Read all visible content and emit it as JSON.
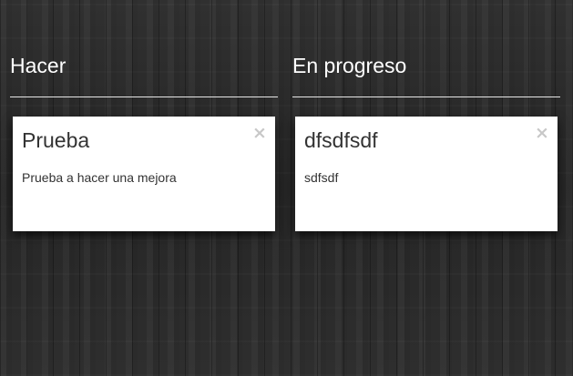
{
  "columns": [
    {
      "title": "Hacer",
      "cards": [
        {
          "title": "Prueba",
          "description": "Prueba a hacer una mejora",
          "close_glyph": "×"
        }
      ]
    },
    {
      "title": "En progreso",
      "cards": [
        {
          "title": "dfsdfsdf",
          "description": "sdfsdf",
          "close_glyph": "×"
        }
      ]
    }
  ],
  "colors": {
    "background": "#2b2b2b",
    "column_title": "#ffffff",
    "divider": "#e6e6e6",
    "card_background": "#ffffff",
    "card_text": "#333333",
    "close_icon": "#c8c8c8"
  },
  "icons": {
    "card_close": "close-icon"
  }
}
